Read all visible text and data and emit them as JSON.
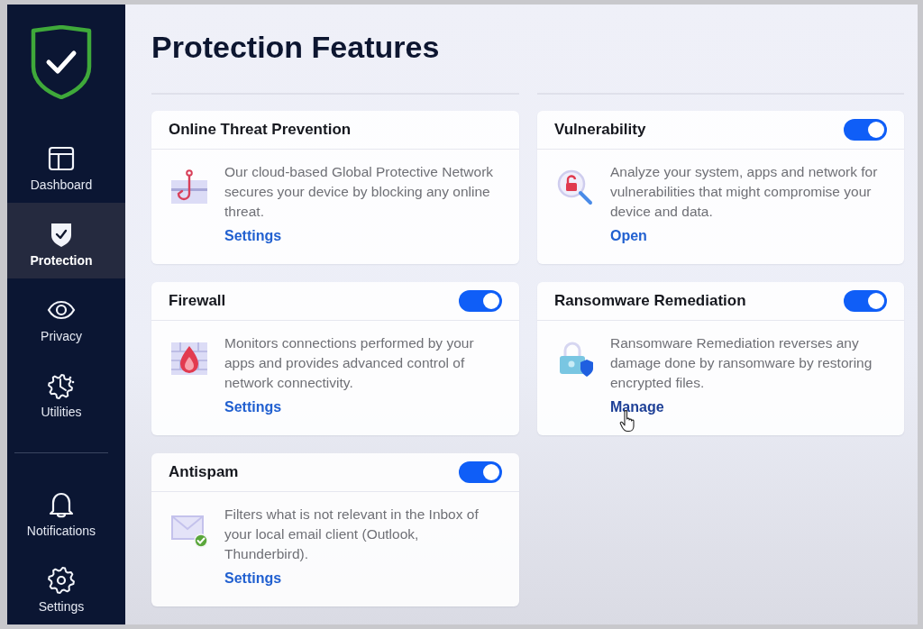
{
  "nav": {
    "items": [
      {
        "label": "Dashboard",
        "selected": false
      },
      {
        "label": "Protection",
        "selected": true
      },
      {
        "label": "Privacy",
        "selected": false
      },
      {
        "label": "Utilities",
        "selected": false
      }
    ],
    "bottom_items": [
      {
        "label": "Notifications",
        "selected": false
      },
      {
        "label": "Settings",
        "selected": false
      }
    ]
  },
  "page": {
    "title": "Protection Features"
  },
  "features": [
    {
      "title": "Online Threat Prevention",
      "kind": "plain",
      "description": "Our cloud-based Global Protective Network secures your device by blocking any online threat.",
      "link": {
        "label": "Settings",
        "hovered": false
      }
    },
    {
      "title": "Vulnerability",
      "kind": "toggle",
      "on": true,
      "description": "Analyze your system, apps and network for vulnerabilities that might compromise your device and data.",
      "link": {
        "label": "Open",
        "hovered": false
      }
    },
    {
      "title": "Firewall",
      "kind": "toggle",
      "on": true,
      "description": "Monitors connections performed by your apps and provides advanced control of network connectivity.",
      "link": {
        "label": "Settings",
        "hovered": false
      }
    },
    {
      "title": "Ransomware Remediation",
      "kind": "toggle",
      "on": true,
      "description": "Ransomware Remediation reverses any damage done by ransomware by restoring encrypted files.",
      "link": {
        "label": "Manage",
        "hovered": true
      }
    },
    {
      "title": "Antispam",
      "kind": "toggle",
      "on": true,
      "description": "Filters what is not relevant in the Inbox of your local email client (Outlook, Thunderbird).",
      "link": {
        "label": "Settings",
        "hovered": false
      }
    }
  ]
}
